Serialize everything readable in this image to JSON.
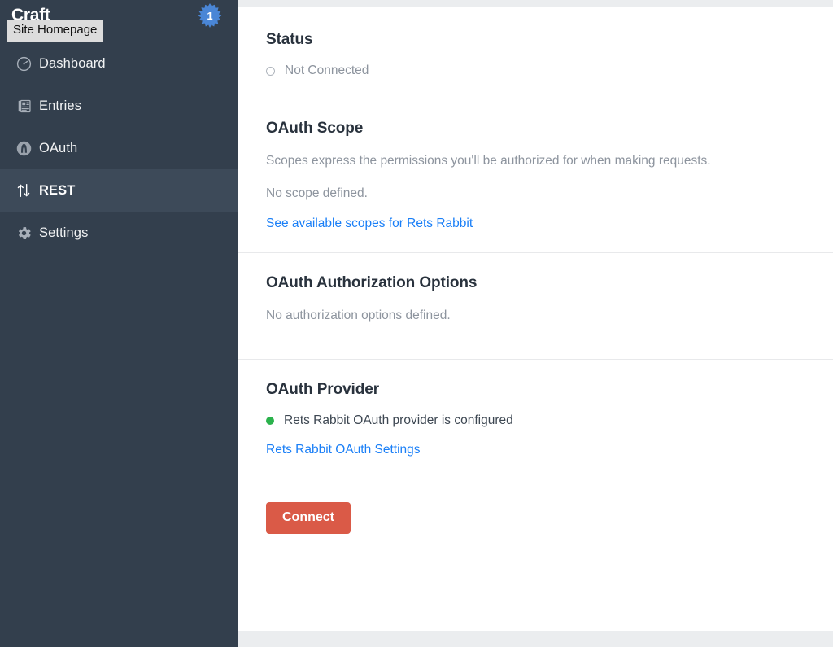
{
  "sidebar": {
    "brand": "Craft",
    "tooltip": "Site Homepage",
    "badge_count": "1",
    "badge_color": "#4a86d6",
    "items": [
      {
        "label": "Dashboard",
        "icon": "gauge-icon",
        "active": false
      },
      {
        "label": "Entries",
        "icon": "newspaper-icon",
        "active": false
      },
      {
        "label": "OAuth",
        "icon": "oauth-circle-a-icon",
        "active": false
      },
      {
        "label": "REST",
        "icon": "up-down-arrows-icon",
        "active": true
      },
      {
        "label": "Settings",
        "icon": "gear-icon",
        "active": false
      }
    ]
  },
  "main": {
    "status": {
      "title": "Status",
      "indicator": "empty-circle",
      "text": "Not Connected"
    },
    "oauth_scope": {
      "title": "OAuth Scope",
      "description": "Scopes express the permissions you'll be authorized for when making requests.",
      "value": "No scope defined.",
      "link": "See available scopes for Rets Rabbit"
    },
    "oauth_authorization_options": {
      "title": "OAuth Authorization Options",
      "value": "No authorization options defined."
    },
    "oauth_provider": {
      "title": "OAuth Provider",
      "indicator": "green-dot",
      "indicator_color": "#2bb24c",
      "text": "Rets Rabbit OAuth provider is configured",
      "link": "Rets Rabbit OAuth Settings"
    },
    "connect": {
      "label": "Connect",
      "color": "#da5a47"
    }
  }
}
